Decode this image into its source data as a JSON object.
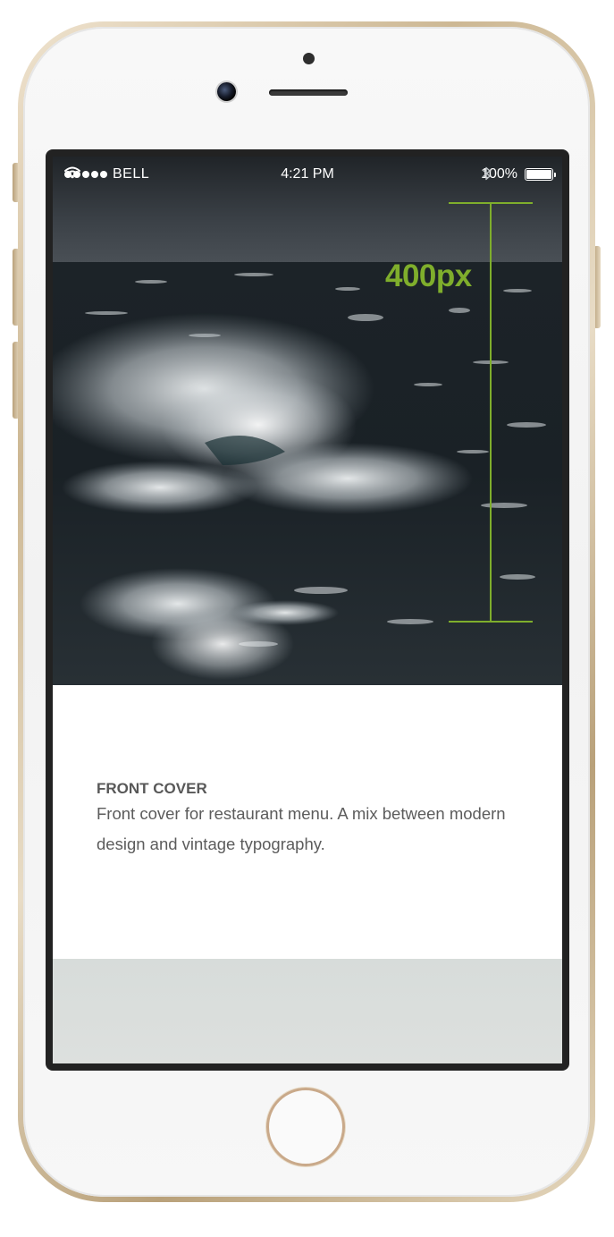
{
  "status_bar": {
    "carrier": "BELL",
    "time": "4:21 PM",
    "battery": "100%"
  },
  "annotation": {
    "height_label": "400px",
    "color": "#7fae2c"
  },
  "card": {
    "title": "FRONT COVER",
    "description": "Front cover for restaurant menu. A mix between modern design and vintage typography."
  },
  "icons": [
    "signal-icon",
    "wifi-icon",
    "bluetooth-icon",
    "battery-icon"
  ],
  "colors": {
    "phone_frame": "#cdb894",
    "annotation": "#7fae2c"
  }
}
